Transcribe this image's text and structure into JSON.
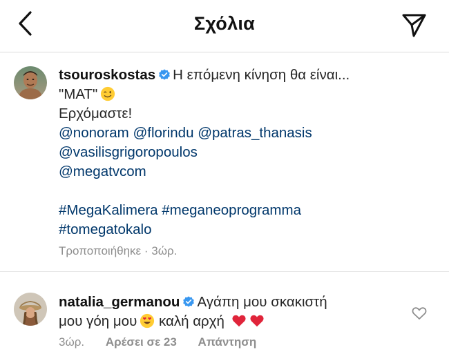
{
  "header": {
    "title": "Σχόλια",
    "back_icon": "chevron-left-icon",
    "send_icon": "paper-plane-icon"
  },
  "caption": {
    "username": "tsouroskostas",
    "verified": true,
    "text_line1": "Η επόμενη κίνηση θα είναι...",
    "text_line2": "\"ΜΑΤ\"",
    "text_line2_emoji": "winking-face",
    "text_line3": "Ερχόμαστε!",
    "mentions_line1": [
      "@nonoram",
      "@florindu",
      "@patras_thanasis"
    ],
    "mentions_line2": "@vasilisgrigoropoulos",
    "mentions_line3": "@megatvcom",
    "hashtags_line1": [
      "#MegaKalimera",
      "#meganeoprogramma"
    ],
    "hashtags_line2": "#tomegatokalo",
    "meta": "Τροποποιήθηκε · 3ώρ."
  },
  "comment": {
    "username": "natalia_germanou",
    "verified": true,
    "text_line1": "Αγάπη μου σκακιστή",
    "text_line2": "μου γόη μου",
    "text_line2_emoji": "heart-eyes-face",
    "text_line2_after": "καλή αρχή",
    "trailing_emojis": [
      "red-heart",
      "red-heart"
    ],
    "time": "3ώρ.",
    "likes": "Αρέσει σε 23",
    "reply": "Απάντηση",
    "like_icon": "heart-outline-icon"
  },
  "colors": {
    "link": "#00376b",
    "meta": "#8e8e8e",
    "verified": "#3897f0",
    "divider": "#dbdbdb"
  }
}
